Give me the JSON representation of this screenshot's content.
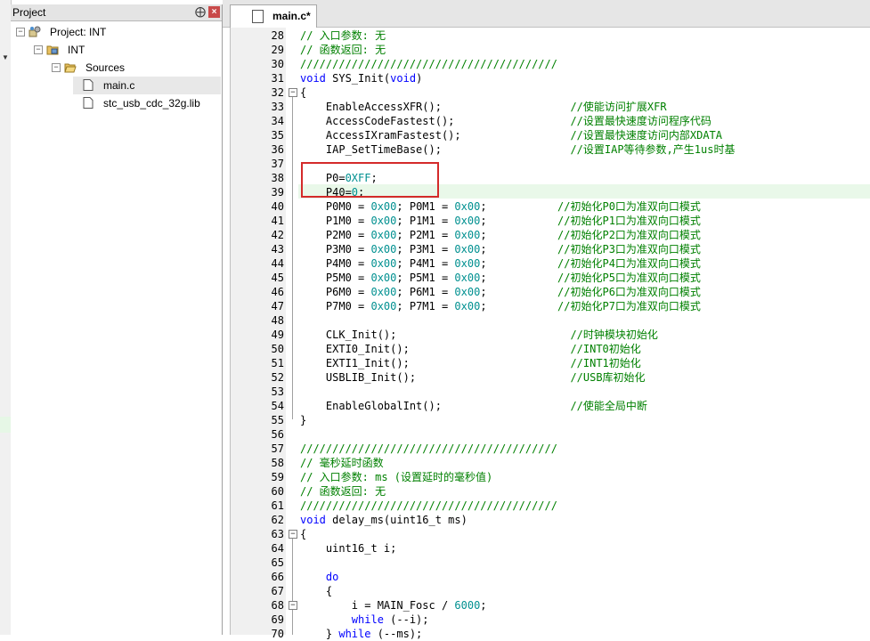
{
  "project_panel": {
    "title": "Project",
    "pin": "⨁",
    "close": "×",
    "tree": [
      {
        "label": "Project: INT",
        "level": 0,
        "type": "project"
      },
      {
        "label": "INT",
        "level": 1,
        "type": "target"
      },
      {
        "label": "Sources",
        "level": 2,
        "type": "folder"
      },
      {
        "label": "main.c",
        "level": 3,
        "type": "file",
        "selected": true
      },
      {
        "label": "stc_usb_cdc_32g.lib",
        "level": 3,
        "type": "file"
      }
    ]
  },
  "editor": {
    "tab_label": "main.c*",
    "lines": [
      {
        "n": "28",
        "segs": [
          [
            "c",
            "// 入口参数: 无"
          ]
        ]
      },
      {
        "n": "29",
        "segs": [
          [
            "c",
            "// 函数返回: 无"
          ]
        ]
      },
      {
        "n": "30",
        "segs": [
          [
            "c",
            "////////////////////////////////////////"
          ]
        ]
      },
      {
        "n": "31",
        "segs": [
          [
            "k",
            "void"
          ],
          [
            "t",
            " SYS_Init("
          ],
          [
            "k",
            "void"
          ],
          [
            "t",
            ")"
          ]
        ]
      },
      {
        "n": "32",
        "segs": [
          [
            "t",
            "{"
          ]
        ]
      },
      {
        "n": "33",
        "segs": [
          [
            "t",
            "    EnableAccessXFR();                    "
          ],
          [
            "c",
            "//使能访问扩展XFR"
          ]
        ]
      },
      {
        "n": "34",
        "segs": [
          [
            "t",
            "    AccessCodeFastest();                  "
          ],
          [
            "c",
            "//设置最快速度访问程序代码"
          ]
        ]
      },
      {
        "n": "35",
        "segs": [
          [
            "t",
            "    AccessIXramFastest();                 "
          ],
          [
            "c",
            "//设置最快速度访问内部XDATA"
          ]
        ]
      },
      {
        "n": "36",
        "segs": [
          [
            "t",
            "    IAP_SetTimeBase();                    "
          ],
          [
            "c",
            "//设置IAP等待参数,产生1us时基"
          ]
        ]
      },
      {
        "n": "37",
        "segs": []
      },
      {
        "n": "38",
        "segs": [
          [
            "t",
            "    P0="
          ],
          [
            "n",
            "0XFF"
          ],
          [
            "t",
            ";"
          ]
        ]
      },
      {
        "n": "39",
        "segs": [
          [
            "t",
            "    P40="
          ],
          [
            "n",
            "0"
          ],
          [
            "t",
            ";"
          ]
        ]
      },
      {
        "n": "40",
        "segs": [
          [
            "t",
            "    P0M0 = "
          ],
          [
            "n",
            "0x00"
          ],
          [
            "t",
            "; P0M1 = "
          ],
          [
            "n",
            "0x00"
          ],
          [
            "t",
            ";           "
          ],
          [
            "c",
            "//初始化P0口为准双向口模式"
          ]
        ]
      },
      {
        "n": "41",
        "segs": [
          [
            "t",
            "    P1M0 = "
          ],
          [
            "n",
            "0x00"
          ],
          [
            "t",
            "; P1M1 = "
          ],
          [
            "n",
            "0x00"
          ],
          [
            "t",
            ";           "
          ],
          [
            "c",
            "//初始化P1口为准双向口模式"
          ]
        ]
      },
      {
        "n": "42",
        "segs": [
          [
            "t",
            "    P2M0 = "
          ],
          [
            "n",
            "0x00"
          ],
          [
            "t",
            "; P2M1 = "
          ],
          [
            "n",
            "0x00"
          ],
          [
            "t",
            ";           "
          ],
          [
            "c",
            "//初始化P2口为准双向口模式"
          ]
        ]
      },
      {
        "n": "43",
        "segs": [
          [
            "t",
            "    P3M0 = "
          ],
          [
            "n",
            "0x00"
          ],
          [
            "t",
            "; P3M1 = "
          ],
          [
            "n",
            "0x00"
          ],
          [
            "t",
            ";           "
          ],
          [
            "c",
            "//初始化P3口为准双向口模式"
          ]
        ]
      },
      {
        "n": "44",
        "segs": [
          [
            "t",
            "    P4M0 = "
          ],
          [
            "n",
            "0x00"
          ],
          [
            "t",
            "; P4M1 = "
          ],
          [
            "n",
            "0x00"
          ],
          [
            "t",
            ";           "
          ],
          [
            "c",
            "//初始化P4口为准双向口模式"
          ]
        ]
      },
      {
        "n": "45",
        "segs": [
          [
            "t",
            "    P5M0 = "
          ],
          [
            "n",
            "0x00"
          ],
          [
            "t",
            "; P5M1 = "
          ],
          [
            "n",
            "0x00"
          ],
          [
            "t",
            ";           "
          ],
          [
            "c",
            "//初始化P5口为准双向口模式"
          ]
        ]
      },
      {
        "n": "46",
        "segs": [
          [
            "t",
            "    P6M0 = "
          ],
          [
            "n",
            "0x00"
          ],
          [
            "t",
            "; P6M1 = "
          ],
          [
            "n",
            "0x00"
          ],
          [
            "t",
            ";           "
          ],
          [
            "c",
            "//初始化P6口为准双向口模式"
          ]
        ]
      },
      {
        "n": "47",
        "segs": [
          [
            "t",
            "    P7M0 = "
          ],
          [
            "n",
            "0x00"
          ],
          [
            "t",
            "; P7M1 = "
          ],
          [
            "n",
            "0x00"
          ],
          [
            "t",
            ";           "
          ],
          [
            "c",
            "//初始化P7口为准双向口模式"
          ]
        ]
      },
      {
        "n": "48",
        "segs": []
      },
      {
        "n": "49",
        "segs": [
          [
            "t",
            "    CLK_Init();                           "
          ],
          [
            "c",
            "//时钟模块初始化"
          ]
        ]
      },
      {
        "n": "50",
        "segs": [
          [
            "t",
            "    EXTI0_Init();                         "
          ],
          [
            "c",
            "//INT0初始化"
          ]
        ]
      },
      {
        "n": "51",
        "segs": [
          [
            "t",
            "    EXTI1_Init();                         "
          ],
          [
            "c",
            "//INT1初始化"
          ]
        ]
      },
      {
        "n": "52",
        "segs": [
          [
            "t",
            "    USBLIB_Init();                        "
          ],
          [
            "c",
            "//USB库初始化"
          ]
        ]
      },
      {
        "n": "53",
        "segs": []
      },
      {
        "n": "54",
        "segs": [
          [
            "t",
            "    EnableGlobalInt();                    "
          ],
          [
            "c",
            "//使能全局中断"
          ]
        ]
      },
      {
        "n": "55",
        "segs": [
          [
            "t",
            "}"
          ]
        ]
      },
      {
        "n": "56",
        "segs": []
      },
      {
        "n": "57",
        "segs": [
          [
            "c",
            "////////////////////////////////////////"
          ]
        ]
      },
      {
        "n": "58",
        "segs": [
          [
            "c",
            "// 毫秒延时函数"
          ]
        ]
      },
      {
        "n": "59",
        "segs": [
          [
            "c",
            "// 入口参数: ms (设置延时的毫秒值)"
          ]
        ]
      },
      {
        "n": "60",
        "segs": [
          [
            "c",
            "// 函数返回: 无"
          ]
        ]
      },
      {
        "n": "61",
        "segs": [
          [
            "c",
            "////////////////////////////////////////"
          ]
        ]
      },
      {
        "n": "62",
        "segs": [
          [
            "k",
            "void"
          ],
          [
            "t",
            " delay_ms(uint16_t ms)"
          ]
        ]
      },
      {
        "n": "63",
        "segs": [
          [
            "t",
            "{"
          ]
        ]
      },
      {
        "n": "64",
        "segs": [
          [
            "t",
            "    uint16_t i;"
          ]
        ]
      },
      {
        "n": "65",
        "segs": []
      },
      {
        "n": "66",
        "segs": [
          [
            "t",
            "    "
          ],
          [
            "k",
            "do"
          ]
        ]
      },
      {
        "n": "67",
        "segs": [
          [
            "t",
            "    {"
          ]
        ]
      },
      {
        "n": "68",
        "segs": [
          [
            "t",
            "        i = MAIN_Fosc / "
          ],
          [
            "n",
            "6000"
          ],
          [
            "t",
            ";"
          ]
        ]
      },
      {
        "n": "69",
        "segs": [
          [
            "t",
            "        "
          ],
          [
            "k",
            "while"
          ],
          [
            "t",
            " (--i);"
          ]
        ]
      },
      {
        "n": "70",
        "segs": [
          [
            "t",
            "    } "
          ],
          [
            "k",
            "while"
          ],
          [
            "t",
            " (--ms);"
          ]
        ]
      }
    ]
  },
  "colors": {
    "comment": "#008000",
    "keyword": "#0000ff",
    "number": "#009090",
    "highlight_box": "#d42a2a"
  }
}
